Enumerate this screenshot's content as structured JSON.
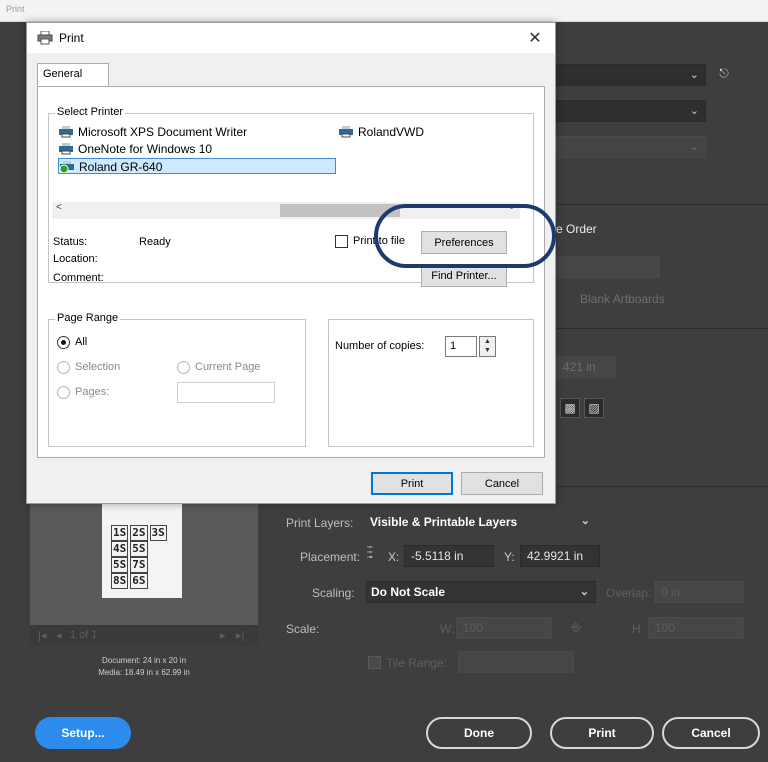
{
  "background": {
    "top_strip_text": "Print",
    "order_label": "e Order",
    "blank_artboards_label": "Blank Artboards",
    "small_field_value": "421 in",
    "print_layers_label": "Print Layers:",
    "print_layers_value": "Visible & Printable Layers",
    "placement_label": "Placement:",
    "x_label": "X:",
    "x_value": "-5.5118 in",
    "y_label": "Y:",
    "y_value": "42.9921 in",
    "scaling_label": "Scaling:",
    "scaling_value": "Do Not Scale",
    "overlap_label": "Overlap:",
    "overlap_value": "0 in",
    "scale_label": "Scale:",
    "w_label": "W:",
    "w_value": "100",
    "h_label": "H:",
    "h_value": "100",
    "tile_range_label": "Tile Range:",
    "pager_text": "1 of 1",
    "document_info": "Document: 24 in x 20 in",
    "media_info": "Media: 18.49 in x 62.99 in",
    "preview_rows": [
      [
        "1S",
        "2S",
        "3S"
      ],
      [
        "4S",
        "5S"
      ],
      [
        "5S",
        "7S"
      ],
      [
        "8S",
        "6S"
      ]
    ],
    "setup_button": "Setup...",
    "done_button": "Done",
    "print_button": "Print",
    "cancel_button": "Cancel"
  },
  "dialog": {
    "title": "Print",
    "close_glyph": "✕",
    "tab_general": "General",
    "select_printer_label": "Select Printer",
    "printers": [
      {
        "name": "Microsoft XPS Document Writer"
      },
      {
        "name": "OneNote for Windows 10"
      },
      {
        "name": "Roland GR-640"
      },
      {
        "name": "RolandVWD"
      }
    ],
    "status_label": "Status:",
    "status_value": "Ready",
    "location_label": "Location:",
    "comment_label": "Comment:",
    "print_to_file_label": "Print to file",
    "preferences_button": "Preferences",
    "find_printer_button": "Find Printer...",
    "page_range_label": "Page Range",
    "all_label": "All",
    "selection_label": "Selection",
    "current_page_label": "Current Page",
    "pages_label": "Pages:",
    "copies_label": "Number of copies:",
    "copies_value": "1",
    "print_button": "Print",
    "cancel_button": "Cancel"
  },
  "colors": {
    "accent_blue": "#2d8ceb",
    "annotation_navy": "#1b3a6e",
    "panel_dark": "#3e3e3e"
  }
}
